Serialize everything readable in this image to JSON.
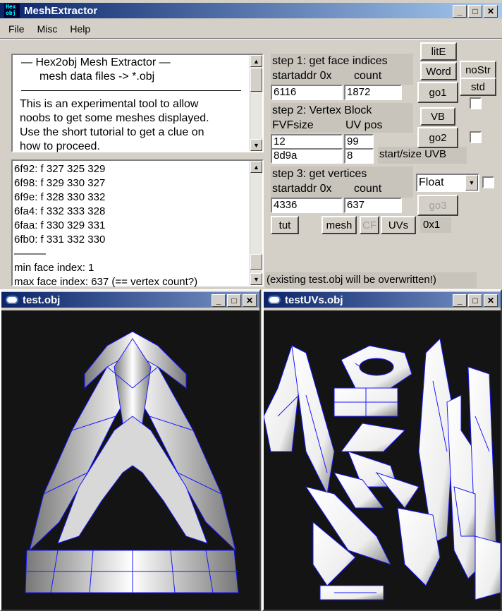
{
  "main_window": {
    "title": "MeshExtractor",
    "app_icon_text": "Hex obj",
    "menu": [
      "File",
      "Misc",
      "Help"
    ]
  },
  "info_text": {
    "line1": "—   Hex2obj Mesh Extractor   —",
    "line2": "mesh data files -> *.obj",
    "desc": [
      "This is an experimental tool to allow",
      "noobs to get some meshes displayed.",
      "Use the short tutorial to get a clue on",
      "how to proceed."
    ]
  },
  "log": {
    "lines": [
      "6f92: f  327 325 329",
      "6f98: f  329 330 327",
      "6f9e: f  328 330 332",
      "6fa4: f  332 333 328",
      "6faa: f  330 329 331",
      "6fb0: f  331 332 330",
      "———",
      "min face index: 1",
      "max face index: 637 (== vertex count?)"
    ]
  },
  "step1": {
    "title": "step 1: get face indices",
    "addr_label": "startaddr 0x",
    "count_label": "count",
    "addr": "6116",
    "count": "1872"
  },
  "step2": {
    "title": "step 2: Vertex Block",
    "fvf_label": "FVFsize",
    "uv_label": "UV pos",
    "fvf": "12",
    "uv": "99",
    "uvb_start": "8d9a",
    "uvb_size": "8",
    "uvb_label": "start/size UVB"
  },
  "step3": {
    "title": "step 3: get vertices",
    "addr_label": "startaddr 0x",
    "count_label": "count",
    "addr": "4336",
    "count": "637",
    "type": "Float"
  },
  "buttons": {
    "litE": "litE",
    "word": "Word",
    "nostr": "noStr",
    "go1": "go1",
    "std": "std",
    "vb": "VB",
    "go2": "go2",
    "go3": "go3",
    "tut": "tut",
    "mesh": "mesh",
    "cf": "CF",
    "uvs": "UVs",
    "hex": "0x1"
  },
  "warning": "(existing test.obj will be overwritten!)",
  "child1": {
    "title": "test.obj"
  },
  "child2": {
    "title": "testUVs.obj"
  }
}
